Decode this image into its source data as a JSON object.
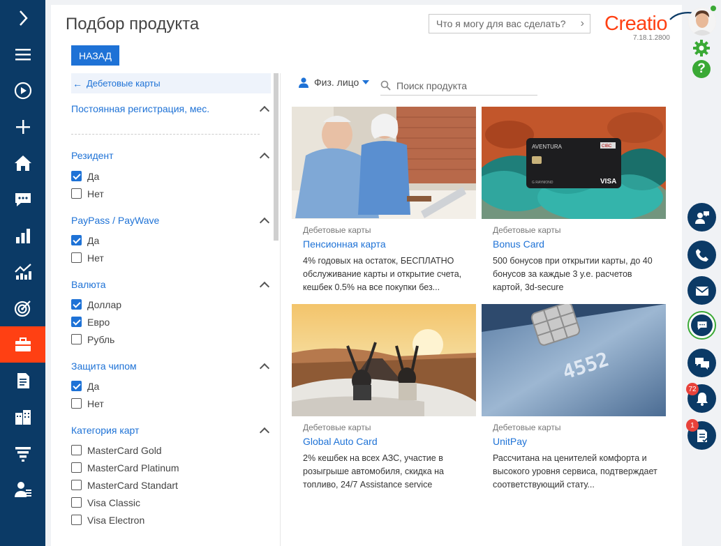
{
  "nav": {
    "items": [
      {
        "name": "toggle-panel-icon"
      },
      {
        "name": "menu-icon"
      },
      {
        "name": "play-icon"
      },
      {
        "name": "plus-icon"
      },
      {
        "name": "home-icon"
      },
      {
        "name": "feed-icon"
      },
      {
        "name": "dashboards-icon"
      },
      {
        "name": "analytics-icon"
      },
      {
        "name": "target-icon"
      },
      {
        "name": "products-icon"
      },
      {
        "name": "document-icon"
      },
      {
        "name": "accounts-icon"
      },
      {
        "name": "funnel-icon"
      },
      {
        "name": "contacts-icon"
      }
    ]
  },
  "header": {
    "title": "Подбор продукта",
    "ask_placeholder": "Что я могу для вас сделать?",
    "logo": "Creatio",
    "version": "7.18.1.2800"
  },
  "back_label": "НАЗАД",
  "filters": {
    "crumb": "Дебетовые карты",
    "sections": [
      {
        "title": "Постоянная регистрация, мес.",
        "options": []
      },
      {
        "title": "Резидент",
        "options": [
          {
            "label": "Да",
            "checked": true
          },
          {
            "label": "Нет",
            "checked": false
          }
        ]
      },
      {
        "title": "PayPass / PayWave",
        "options": [
          {
            "label": "Да",
            "checked": true
          },
          {
            "label": "Нет",
            "checked": false
          }
        ]
      },
      {
        "title": "Валюта",
        "options": [
          {
            "label": "Доллар",
            "checked": true
          },
          {
            "label": "Евро",
            "checked": true
          },
          {
            "label": "Рубль",
            "checked": false
          }
        ]
      },
      {
        "title": "Защита чипом",
        "options": [
          {
            "label": "Да",
            "checked": true
          },
          {
            "label": "Нет",
            "checked": false
          }
        ]
      },
      {
        "title": "Категория карт",
        "options": [
          {
            "label": "MasterCard Gold",
            "checked": false
          },
          {
            "label": "MasterCard Platinum",
            "checked": false
          },
          {
            "label": "MasterCard Standart",
            "checked": false
          },
          {
            "label": "Visa Classic",
            "checked": false
          },
          {
            "label": "Visa Electron",
            "checked": false
          }
        ]
      }
    ]
  },
  "persona": "Физ. лицо",
  "search_placeholder": "Поиск продукта",
  "products": [
    {
      "category": "Дебетовые карты",
      "name": "Пенсионная карта",
      "desc": "4% годовых на остаток, БЕСПЛАТНО обслуживание карты и открытие счета, кешбек 0.5% на все покупки без..."
    },
    {
      "category": "Дебетовые карты",
      "name": "Bonus Card",
      "desc": "500 бонусов при открытии карты, до 40 бонусов за каждые 3 у.е. расчетов картой, 3d-secure",
      "card_brand": "AVENTURA",
      "card_bank": "CIBC",
      "card_network": "VISA",
      "card_holder": "G RAYMOND"
    },
    {
      "category": "Дебетовые карты",
      "name": "Global Auto Card",
      "desc": "2% кешбек на всех АЗС, участие в розыгрыше автомобиля, скидка на топливо, 24/7 Assistance service"
    },
    {
      "category": "Дебетовые карты",
      "name": "UnitPay",
      "desc": "Рассчитана на ценителей комфорта и высокого уровня сервиса, подтверждает соответствующий стату...",
      "card_digits": "4552"
    }
  ],
  "rail": {
    "badges": {
      "notifications": "72",
      "tasks": "1"
    },
    "colors": {
      "nav": "#0b3a66",
      "accent": "#ff4013",
      "link": "#1e72d6",
      "green": "#3aa935"
    }
  }
}
